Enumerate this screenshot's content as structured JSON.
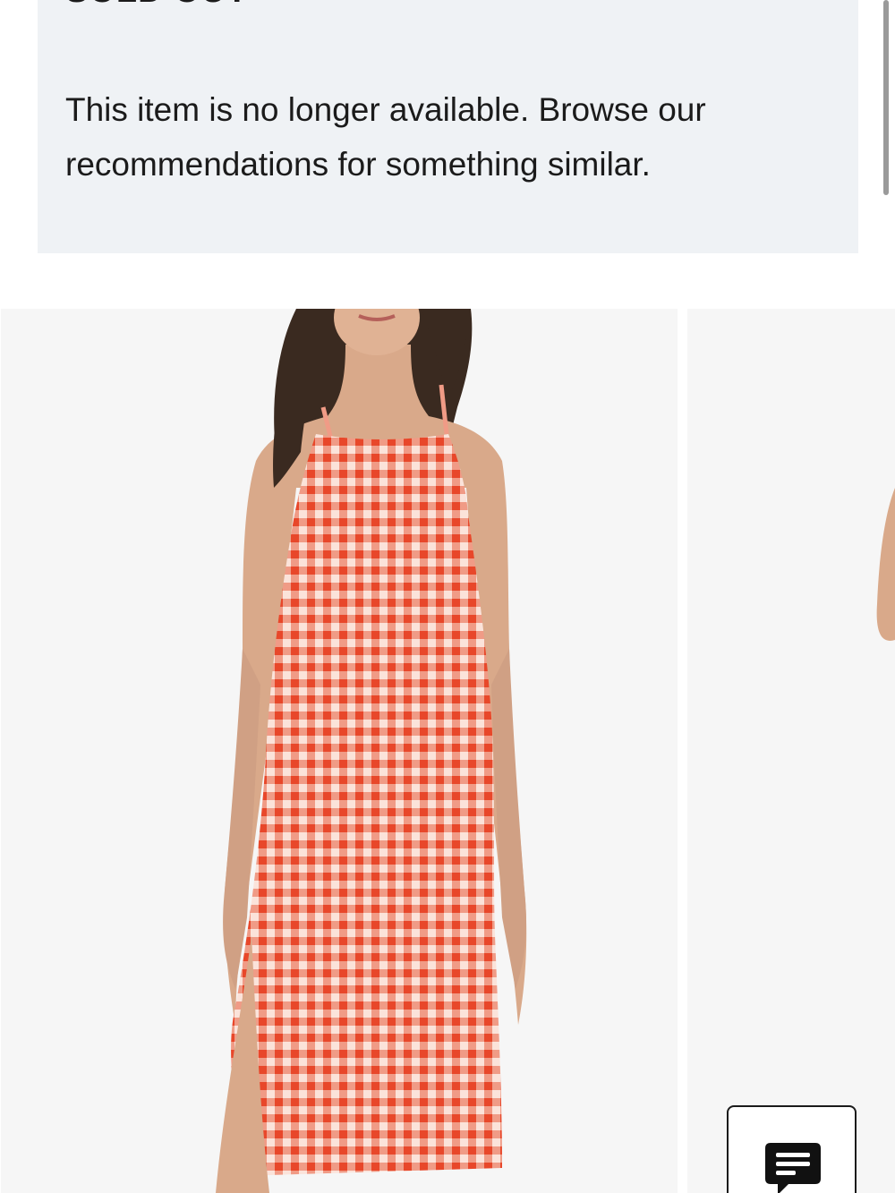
{
  "notice": {
    "title": "SOLD OUT",
    "message": "This item is no longer available. Browse our recommendations for something similar."
  },
  "recommendations": [
    {
      "image": "red-white-gingham-midi-dress-photo",
      "pattern_colors": [
        "#e8472a",
        "#fbe3da"
      ]
    },
    {
      "image": "partially-visible-dress-photo"
    }
  ],
  "chat": {
    "icon": "chat-bubble-icon"
  },
  "colors": {
    "notice_bg": "#eff2f5",
    "text": "#1b1b1b",
    "card_bg": "#f6f6f6",
    "gingham_red": "#e8472a"
  }
}
